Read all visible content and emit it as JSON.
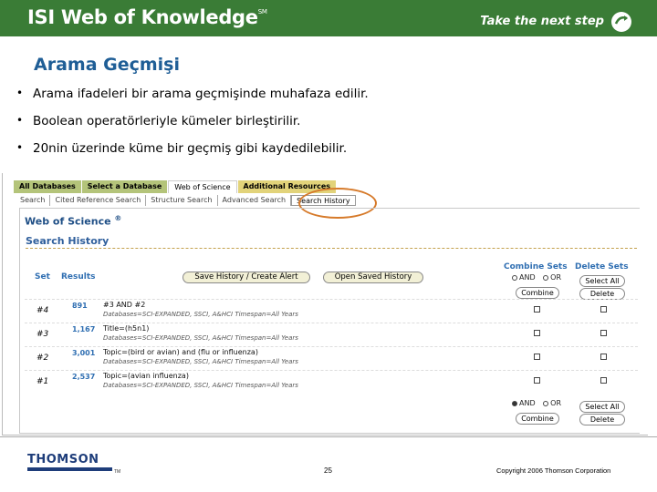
{
  "banner": {
    "brand": "ISI Web of Knowledge",
    "brand_mark": "SM",
    "tagline": "Take the next step",
    "tagline_icon": "arrow-circle-icon",
    "color": "#3a7c36"
  },
  "slide": {
    "title": "Arama Geçmişi",
    "bullets": [
      "Arama ifadeleri bir arama geçmişinde  muhafaza edilir.",
      "Boolean operatörleriyle kümeler birleştirilir.",
      "20nin üzerinde küme bir geçmiş gibi kaydedilebilir."
    ]
  },
  "screenshot": {
    "tabs": [
      "All Databases",
      "Select a Database",
      "Web of Science",
      "Additional Resources"
    ],
    "subtabs": [
      "Search",
      "Cited Reference Search",
      "Structure Search",
      "Advanced Search",
      "Search History"
    ],
    "product_title": "Web of Science",
    "product_mark": "®",
    "section_title": "Search History",
    "headers": {
      "set": "Set",
      "results": "Results",
      "combine_sets": "Combine Sets",
      "delete_sets": "Delete Sets"
    },
    "buttons": {
      "save_history": "Save History / Create Alert",
      "open_history": "Open Saved History",
      "select_all": "Select All",
      "combine": "Combine",
      "delete": "Delete"
    },
    "radio": {
      "and": "AND",
      "or": "OR"
    },
    "rows": [
      {
        "set": "#4",
        "results": "891",
        "query": "#3 AND #2",
        "databases": "Databases=SCI-EXPANDED, SSCI, A&HCI Timespan=All Years"
      },
      {
        "set": "#3",
        "results": "1,167",
        "query": "Title=(h5n1)",
        "databases": "Databases=SCI-EXPANDED, SSCI, A&HCI Timespan=All Years"
      },
      {
        "set": "#2",
        "results": "3,001",
        "query": "Topic=(bird or avian) and (flu or influenza)",
        "databases": "Databases=SCI-EXPANDED, SSCI, A&HCI Timespan=All Years"
      },
      {
        "set": "#1",
        "results": "2,537",
        "query": "Topic=(avian influenza)",
        "databases": "Databases=SCI-EXPANDED, SSCI, A&HCI Timespan=All Years"
      }
    ]
  },
  "footer": {
    "logo": "THOMSON",
    "logo_mark": "TM",
    "page": "25",
    "copyright": "Copyright 2006 Thomson Corporation"
  }
}
